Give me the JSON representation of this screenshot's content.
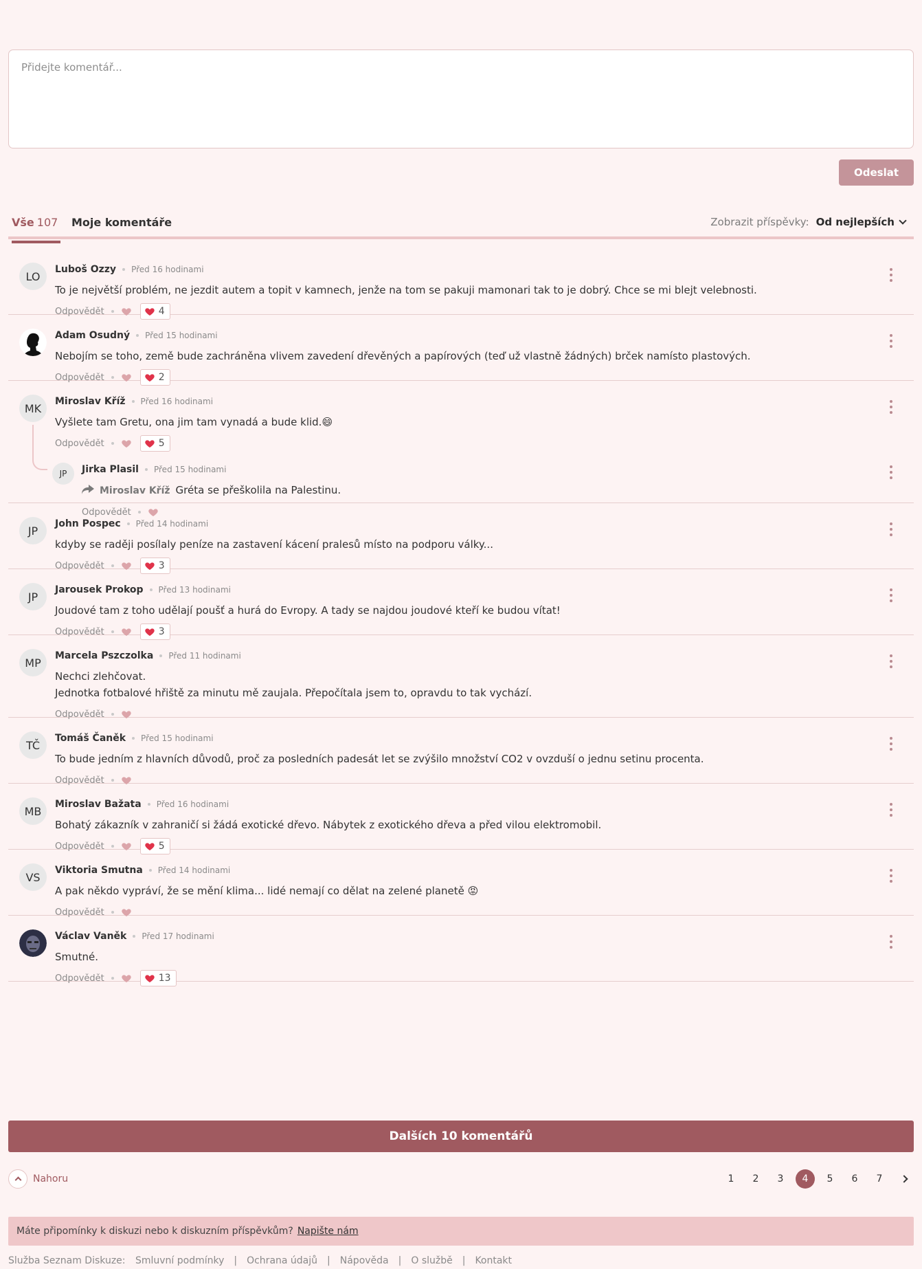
{
  "composer": {
    "placeholder": "Přidejte komentář...",
    "send_label": "Odeslat"
  },
  "tabs": {
    "all_label": "Vše",
    "all_count": "107",
    "mine_label": "Moje komentáře"
  },
  "sort": {
    "label": "Zobrazit příspěvky:",
    "value": "Od nejlepších"
  },
  "reply_label": "Odpovědět",
  "comments": [
    {
      "initials": "LO",
      "name": "Luboš Ozzy",
      "time": "Před 16 hodinami",
      "text": "To je největší problém, ne jezdit autem a topit v kamnech, jenže na tom se pakuji mamonari tak to je dobrý. Chce se mi blejt velebnosti.",
      "reactions": "4"
    },
    {
      "initials": "",
      "name": "Adam Osudný",
      "time": "Před 15 hodinami",
      "text": "Nebojím se toho, země bude zachráněna vlivem zavedení dřevěných a papírových (teď už vlastně žádných) brček namísto plastových.",
      "reactions": "2"
    },
    {
      "initials": "MK",
      "name": "Miroslav Kříž",
      "time": "Před 16 hodinami",
      "text": "Vyšlete tam Gretu, ona jim tam vynadá a bude klid.😄",
      "reactions": "5",
      "reply": {
        "initials": "JP",
        "name": "Jirka Plasil",
        "time": "Před 15 hodinami",
        "reply_to": "Miroslav Kříž",
        "text": "Gréta se přeškolila na Palestinu."
      }
    },
    {
      "initials": "JP",
      "name": "John Pospec",
      "time": "Před 14 hodinami",
      "text": "kdyby se raději posílaly peníze na zastavení kácení pralesů místo na podporu války...",
      "reactions": "3"
    },
    {
      "initials": "JP",
      "name": "Jarousek Prokop",
      "time": "Před 13 hodinami",
      "text": "Joudové tam z toho udělají poušť a hurá do Evropy. A tady se najdou joudové kteří ke budou vítat!",
      "reactions": "3"
    },
    {
      "initials": "MP",
      "name": "Marcela Pszczolka",
      "time": "Před 11 hodinami",
      "text_lines": [
        "Nechci zlehčovat.",
        "Jednotka fotbalové hřiště za minutu mě zaujala. Přepočítala jsem to, opravdu to tak vychází."
      ]
    },
    {
      "initials": "TČ",
      "name": "Tomáš Čaněk",
      "time": "Před 15 hodinami",
      "text": "To bude jedním z hlavních důvodů, proč za posledních padesát let se zvýšilo množství CO2 v ovzduší o jednu setinu procenta."
    },
    {
      "initials": "MB",
      "name": "Miroslav Bažata",
      "time": "Před 16 hodinami",
      "text": "Bohatý zákazník v zahraničí si žádá exotické dřevo. Nábytek z exotického dřeva a před vilou elektromobil.",
      "reactions": "5"
    },
    {
      "initials": "VS",
      "name": "Viktoria Smutna",
      "time": "Před 14 hodinami",
      "text": "A pak někdo vypráví, že se mění klima... lidé nemají co dělat na zelené planetě 😡"
    },
    {
      "initials": "",
      "name": "Václav Vaněk",
      "time": "Před 17 hodinami",
      "text": "Smutné.",
      "reactions": "13"
    }
  ],
  "load_more_label": "Dalších 10 komentářů",
  "back_to_top": "Nahoru",
  "pagination": {
    "pages": [
      "1",
      "2",
      "3",
      "4",
      "5",
      "6",
      "7"
    ],
    "current": "4"
  },
  "feedback": {
    "text": "Máte připomínky k diskuzi nebo k diskuzním příspěvkům?",
    "link": "Napište nám"
  },
  "footer": {
    "label": "Služba Seznam Diskuze:",
    "links": [
      "Smluvní podmínky",
      "Ochrana údajů",
      "Nápověda",
      "O službě",
      "Kontakt"
    ]
  },
  "colors": {
    "accent": "#a05a60",
    "background": "#fdf3f3",
    "heart": "#e0334a",
    "feedback_bg": "#efc7c9"
  }
}
